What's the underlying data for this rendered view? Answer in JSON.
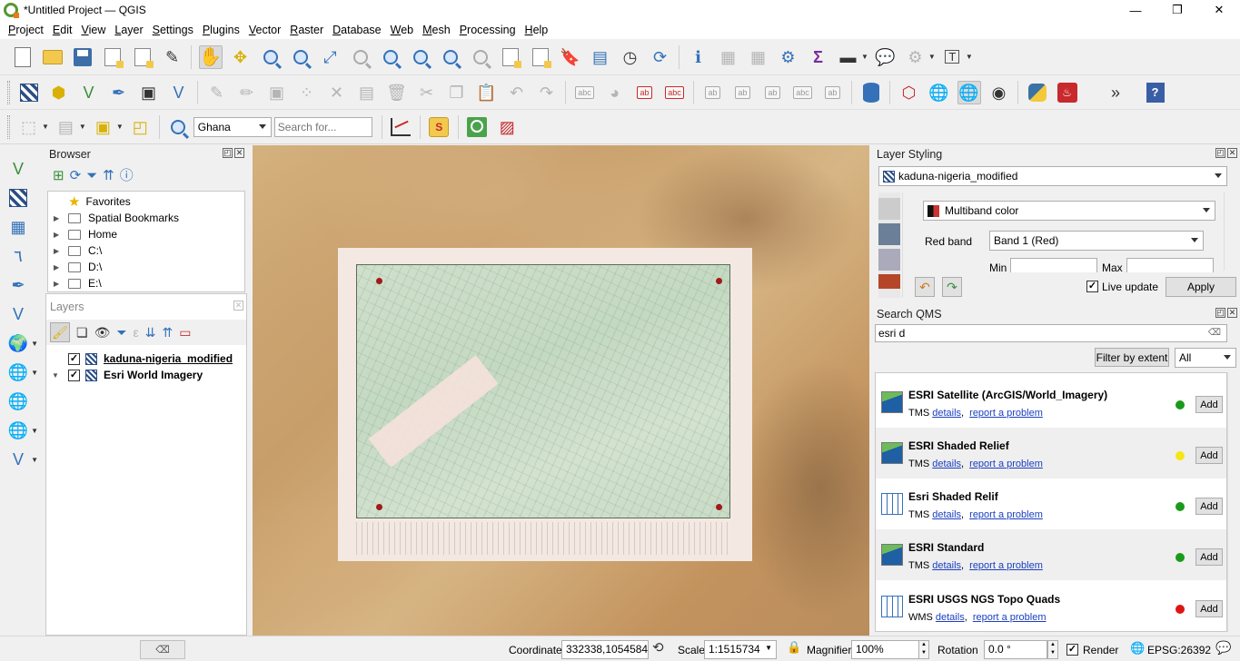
{
  "window": {
    "title": "*Untitled Project — QGIS",
    "minimize": "—",
    "maximize": "❐",
    "close": "✕"
  },
  "menu": [
    "Project",
    "Edit",
    "View",
    "Layer",
    "Settings",
    "Plugins",
    "Vector",
    "Raster",
    "Database",
    "Web",
    "Mesh",
    "Processing",
    "Help"
  ],
  "toolbar3": {
    "locator_combo": "Ghana",
    "search_placeholder": "Search for..."
  },
  "browser": {
    "title": "Browser",
    "items": [
      {
        "label": "Favorites",
        "icon": "star-icon"
      },
      {
        "label": "Spatial Bookmarks",
        "icon": "bookmark-icon"
      },
      {
        "label": "Home",
        "icon": "home-icon"
      },
      {
        "label": "C:\\",
        "icon": "folder-icon"
      },
      {
        "label": "D:\\",
        "icon": "folder-icon"
      },
      {
        "label": "E:\\",
        "icon": "folder-icon"
      }
    ]
  },
  "layers": {
    "title": "Layers",
    "items": [
      {
        "label": "kaduna-nigeria_modified",
        "checked": "✓"
      },
      {
        "label": "Esri World Imagery",
        "checked": "✓"
      }
    ]
  },
  "layer_styling": {
    "title": "Layer Styling",
    "layer": "kaduna-nigeria_modified",
    "renderer": "Multiband color",
    "red_band_label": "Red band",
    "red_band_value": "Band 1 (Red)",
    "min_label": "Min",
    "max_label": "Max",
    "live_update_label": "Live update",
    "live_update_checked": "✓",
    "apply_label": "Apply"
  },
  "search_qms": {
    "title": "Search QMS",
    "query": "esri d",
    "filter_button": "Filter by extent",
    "filter_select": "All",
    "results": [
      {
        "name": "ESRI Satellite (ArcGIS/World_Imagery)",
        "type": "TMS",
        "details": "details",
        "report": "report a problem",
        "status_color": "#1a9a1a",
        "add": "Add",
        "logo": "esri-logo-icon"
      },
      {
        "name": "ESRI Shaded Relief",
        "type": "TMS",
        "details": "details",
        "report": "report a problem",
        "status_color": "#f5e614",
        "add": "Add",
        "logo": "esri-logo-icon"
      },
      {
        "name": "Esri Shaded Relif",
        "type": "TMS",
        "details": "details",
        "report": "report a problem",
        "status_color": "#1a9a1a",
        "add": "Add",
        "logo": "map-icon"
      },
      {
        "name": "ESRI Standard",
        "type": "TMS",
        "details": "details",
        "report": "report a problem",
        "status_color": "#1a9a1a",
        "add": "Add",
        "logo": "esri-logo-icon"
      },
      {
        "name": "ESRI USGS NGS Topo Quads",
        "type": "WMS",
        "details": "details",
        "report": "report a problem",
        "status_color": "#e01414",
        "add": "Add",
        "logo": "map-icon"
      }
    ]
  },
  "statusbar": {
    "coordinate_label": "Coordinate",
    "coordinate_value": "332338,1054584",
    "scale_label": "Scale",
    "scale_value": "1:1515734",
    "magnifier_label": "Magnifier",
    "magnifier_value": "100%",
    "rotation_label": "Rotation",
    "rotation_value": "0.0 °",
    "render_label": "Render",
    "render_checked": "✓",
    "crs": "EPSG:26392"
  },
  "locator": {
    "close": "✕"
  }
}
